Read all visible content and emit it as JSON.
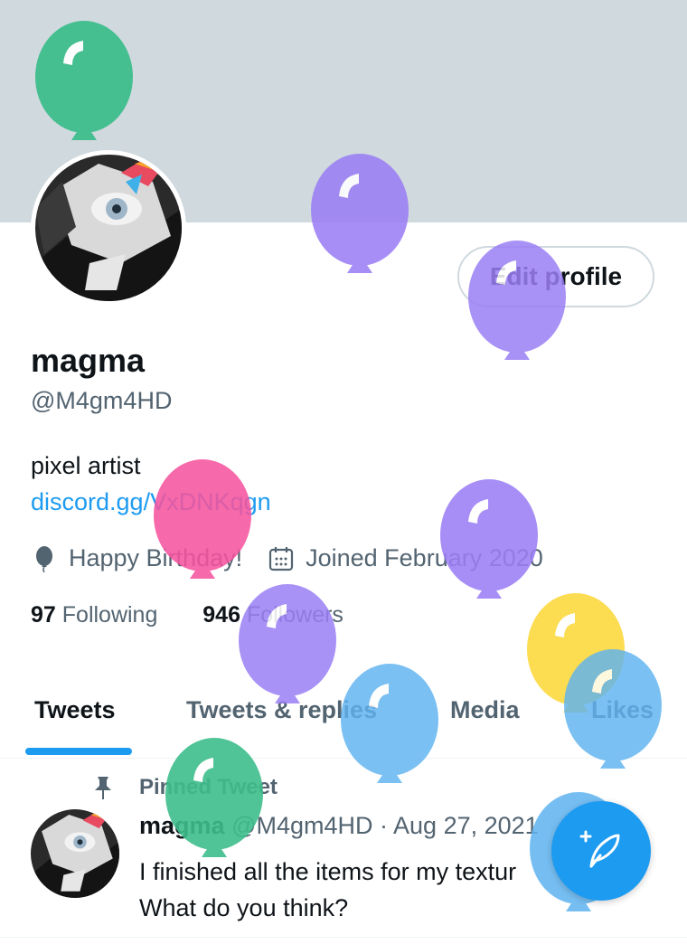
{
  "profile": {
    "name": "magma",
    "handle": "@M4gm4HD",
    "bio": "pixel artist",
    "link": "discord.gg/VxDNKqgn",
    "birthday": "Happy Birthday!",
    "joined": "Joined February 2020",
    "following_count": "97",
    "following_label": "Following",
    "followers_count": "946",
    "followers_label": "Followers",
    "edit_button": "Edit profile"
  },
  "tabs": [
    {
      "label": "Tweets",
      "active": true
    },
    {
      "label": "Tweets & replies",
      "active": false
    },
    {
      "label": "Media",
      "active": false
    },
    {
      "label": "Likes",
      "active": false
    }
  ],
  "tweet": {
    "pinned_label": "Pinned Tweet",
    "author": "magma",
    "handle": "@M4gm4HD",
    "separator": "·",
    "date": "Aug 27, 2021",
    "line1": "I finished all the items for my textur",
    "line2": "What do you think?",
    "more": "·"
  },
  "colors": {
    "accent": "#1d9bf0",
    "banner": "#cfd9de",
    "balloon_green": "#3ebe8c",
    "balloon_purple": "#9b7ff5",
    "balloon_pink": "#f5559f",
    "balloon_blue": "#5fb3f0",
    "balloon_yellow": "#fcd93f"
  },
  "icons": {
    "birthday": "balloon-icon",
    "joined": "calendar-icon",
    "pinned": "pin-icon",
    "compose": "compose-tweet-icon"
  }
}
